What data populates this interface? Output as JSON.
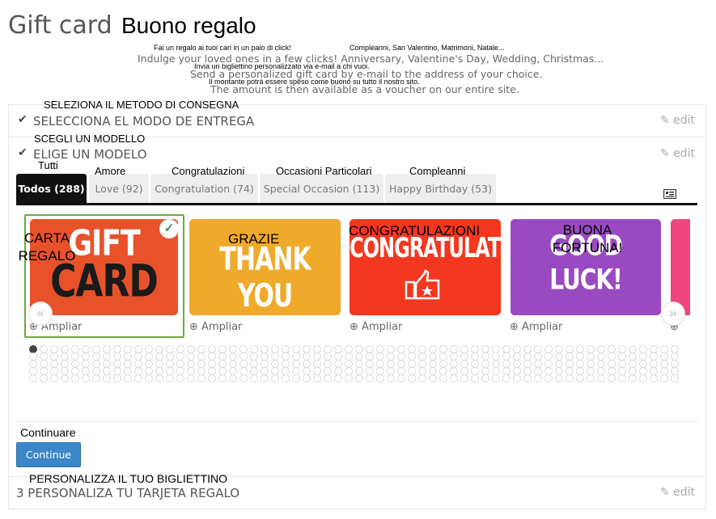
{
  "header": {
    "title": "Gift card",
    "title_overlay": "Buono regalo"
  },
  "intro": {
    "overlay_line1a": "Fai un regalo ai tuoi cari in un paio di click!",
    "overlay_line1b": "Compleanni, San Valentino, Matrimoni, Natale...",
    "line1": "Indulge your loved ones in a few clicks! Anniversary, Valentine's Day, Wedding, Christmas...",
    "overlay_line2": "Invia un bigliettino personalizzato via e-mail a chi vuoi.",
    "line2": "Send a personalized gift card by e-mail to the address of your choice.",
    "overlay_line3": "Il montante potrà essere speso come buono su tutto il nostro sito.",
    "line3": "The amount is then available as a voucher on our entire site."
  },
  "steps": [
    {
      "overlay": "SELEZIONA IL METODO DI CONSEGNA",
      "label": "SELECCIONA EL MODO DE ENTREGA",
      "edit": "edit",
      "check": "✔"
    },
    {
      "overlay": "SCEGLI UN MODELLO",
      "label": "ELIGE UN MODELO",
      "edit": "edit",
      "check": "✔"
    },
    {
      "overlay": "PERSONALIZZA IL TUO BIGLIETTINO",
      "label": "3 PERSONALIZA TU TARJETA REGALO",
      "edit": "edit"
    }
  ],
  "tabs": [
    {
      "label": "Todos (288)",
      "overlay": "Tutti",
      "active": true
    },
    {
      "label": "Love (92)",
      "overlay": "Amore",
      "active": false
    },
    {
      "label": "Congratulation (74)",
      "overlay": "Congratulazioni",
      "active": false
    },
    {
      "label": "Special Occasion (113)",
      "overlay": "Occasioni Particolari",
      "active": false
    },
    {
      "label": "Happy Birthday (53)",
      "overlay": "Compleanni",
      "active": false
    }
  ],
  "cards": [
    {
      "line1": "GIFT",
      "line2": "CARD",
      "overlay": "CARTA REGALO",
      "color": "#e8522a",
      "selected": true
    },
    {
      "line1": "THANK YOU",
      "line2": "",
      "overlay": "GRAZIE",
      "color": "#efaa2b",
      "selected": false
    },
    {
      "line1": "CONGRATULATION",
      "line2": "",
      "overlay": "CONGRATULAZIONI",
      "color": "#f4371f",
      "selected": false
    },
    {
      "line1": "GOOD",
      "line2": "LUCK!",
      "overlay": "BUONA FORTUNA!",
      "color": "#9a4ac0",
      "selected": false
    }
  ],
  "ampliar_label": "Ampliar",
  "carousel": {
    "page_count": 310,
    "current_page": 1
  },
  "continue": {
    "overlay": "Continuare",
    "label": "Continue"
  },
  "icons": {
    "edit": "pencil-icon",
    "view_toggle": "list-view-icon",
    "zoom": "zoom-in-icon",
    "selected": "check-circle-icon",
    "prev": "chevron-left-icon",
    "next": "chevron-right-icon"
  },
  "colors": {
    "accent_blue": "#3a86c8",
    "selected_border": "#6aab3c",
    "active_tab": "#111111"
  }
}
